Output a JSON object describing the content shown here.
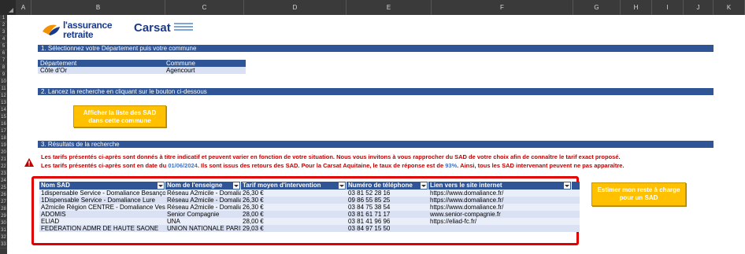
{
  "columns": [
    "A",
    "B",
    "C",
    "D",
    "E",
    "F",
    "G",
    "H",
    "I",
    "J",
    "K"
  ],
  "rows": [
    "1",
    "2",
    "3",
    "4",
    "5",
    "6",
    "7",
    "8",
    "9",
    "10",
    "11",
    "12",
    "13",
    "14",
    "15",
    "16",
    "17",
    "18",
    "19",
    "20",
    "21",
    "22",
    "23",
    "24",
    "25",
    "26",
    "27",
    "28",
    "29",
    "30",
    "31",
    "32",
    "33"
  ],
  "logos": {
    "assurance_line1": "l'assurance",
    "assurance_line2": "retraite",
    "carsat": "Carsat"
  },
  "step1": {
    "title": "1. Sélectionnez votre Département puis votre commune",
    "header_departement": "Département",
    "header_commune": "Commune",
    "departement": "Côte d'Or",
    "commune": "Agencourt"
  },
  "step2": {
    "title": "2. Lancez la recherche en cliquant sur le bouton ci-dessous",
    "button_line1": "Afficher la liste des SAD",
    "button_line2": "dans cette commune"
  },
  "step3": {
    "title": "3. Résultats de la recherche",
    "note1": "Les tarifs présentés ci-après sont donnés à titre indicatif et peuvent varier en fonction de votre situation. Nous vous invitons à vous rapprocher du SAD de votre choix afin de connaître le tarif exact proposé.",
    "note2_a": "Les tarifs présentés ci-après sont en date du ",
    "note2_date": "01/06/2024",
    "note2_b": ". Ils sont issus des retours des SAD. Pour la Carsat Aquitaine, le taux de réponse est de ",
    "note2_rate": "93%",
    "note2_c": ". Ainsi, tous les SAD intervenant peuvent ne pas apparaître."
  },
  "results": {
    "headers": [
      "Nom SAD",
      "Nom de l'enseigne",
      "Tarif moyen d'intervention",
      "Numéro de téléphone",
      "Lien vers le site internet"
    ],
    "rows": [
      [
        "1dispensable Service - Domaliance Besançon",
        "Réseau A2micile - Domaliance",
        "26,30 €",
        "03 81 52 28 16",
        "https://www.domaliance.fr/"
      ],
      [
        "1Dispensable Service - Domaliance Lure",
        "Réseau A2micile - Domaliance",
        "26,30 €",
        "09 86 55 85 25",
        "https://www.domaliance.fr/"
      ],
      [
        "A2micile Région CENTRE - Domaliance Vesoul",
        "Réseau A2micile - Domaliance",
        "26,30 €",
        "03 84 75 38 54",
        "https://www.domaliance.fr/"
      ],
      [
        "ADOMIS",
        "Senior Compagnie",
        "28,00 €",
        "03 81 61 71 17",
        "www.senior-compagnie.fr"
      ],
      [
        "ELIAD",
        "UNA",
        "28,00 €",
        "03 81 41 96 96",
        "https://eliad-fc.fr/"
      ],
      [
        "FEDERATION ADMR DE HAUTE SAONE",
        "UNION NATIONALE PARIS",
        "29,03 €",
        "03 84 97 15 50",
        ""
      ]
    ]
  },
  "estimate_button": {
    "line1": "Estimer mon reste à charge",
    "line2": "pour un SAD"
  },
  "colors": {
    "section_blue": "#2f5597",
    "button_gold": "#ffc000",
    "warning_red": "#c00000",
    "highlight_box": "#e00000"
  }
}
